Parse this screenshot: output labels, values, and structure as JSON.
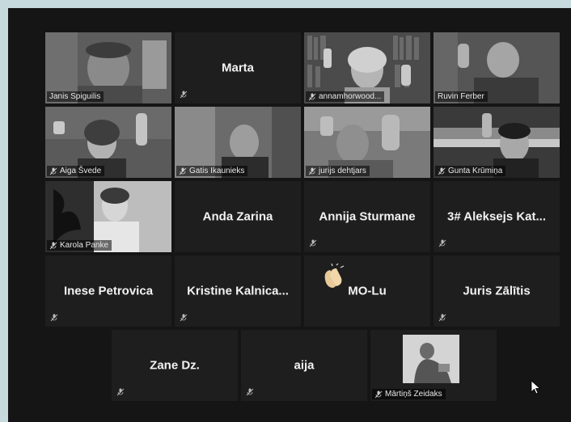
{
  "participants": [
    {
      "name": "Janis Spiguilis",
      "type": "video"
    },
    {
      "name": "Marta",
      "type": "name"
    },
    {
      "name": "annamhorwood...",
      "type": "video"
    },
    {
      "name": "Ruvin Ferber",
      "type": "video"
    },
    {
      "name": "Aiga Švede",
      "type": "video"
    },
    {
      "name": "Gatis Ikaunieks",
      "type": "video"
    },
    {
      "name": "jurijs dehtjars",
      "type": "video"
    },
    {
      "name": "Gunta Krūmiņa",
      "type": "video"
    },
    {
      "name": "Karola Panke",
      "type": "video"
    },
    {
      "name": "Anda Zarina",
      "type": "name"
    },
    {
      "name": "Annija Sturmane",
      "type": "name"
    },
    {
      "name": "3# Aleksejs Kat...",
      "type": "name"
    },
    {
      "name": "Inese Petrovica",
      "type": "name"
    },
    {
      "name": "Kristine Kalnica...",
      "type": "name"
    },
    {
      "name": "MO-Lu",
      "type": "name"
    },
    {
      "name": "Juris Zālītis",
      "type": "name"
    },
    {
      "name": "Zane Dz.",
      "type": "name"
    },
    {
      "name": "aija",
      "type": "name"
    },
    {
      "name": "Mārtiņš Zeidaks",
      "type": "photo"
    }
  ],
  "icons": {
    "mute": "mic-muted-icon",
    "clap": "clapping-hands-icon",
    "cursor": "mouse-pointer-icon"
  },
  "colors": {
    "window_bg": "#151515",
    "tile_bg": "#1e1e1e",
    "page_bg": "#c6d9dc",
    "text": "#f2f2f2"
  }
}
